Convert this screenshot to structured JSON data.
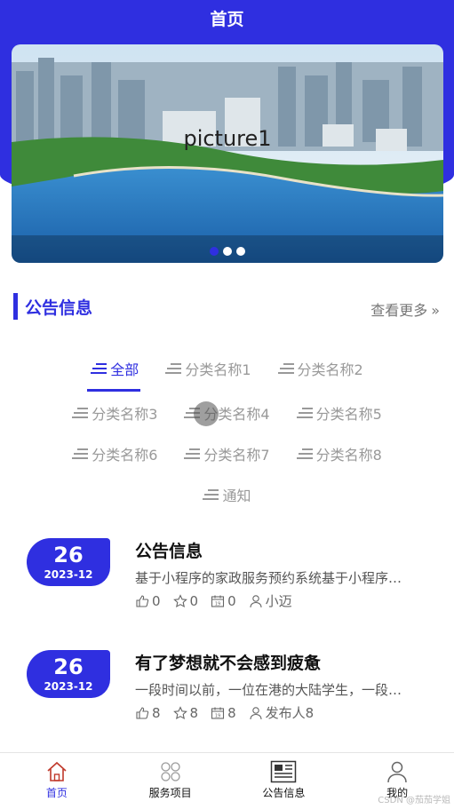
{
  "header": {
    "title": "首页"
  },
  "banner": {
    "caption": "picture1",
    "dots": 3,
    "active_dot": 0
  },
  "notice_section": {
    "title": "公告信息",
    "more_label": "查看更多",
    "more_icon": "double-chevron-right-icon"
  },
  "categories": [
    {
      "label": "全部",
      "active": true
    },
    {
      "label": "分类名称1"
    },
    {
      "label": "分类名称2"
    },
    {
      "label": "分类名称3"
    },
    {
      "label": "分类名称4"
    },
    {
      "label": "分类名称5"
    },
    {
      "label": "分类名称6"
    },
    {
      "label": "分类名称7"
    },
    {
      "label": "分类名称8"
    },
    {
      "label": "通知"
    }
  ],
  "news": [
    {
      "day": "26",
      "year_month": "2023-12",
      "title": "公告信息",
      "desc": "基于小程序的家政服务预约系统基于小程序的家政服务预约系统",
      "likes": "0",
      "favorites": "0",
      "views": "0",
      "author": "小迈"
    },
    {
      "day": "26",
      "year_month": "2023-12",
      "title": "有了梦想就不会感到疲惫",
      "desc": "一段时间以前，一位在港的大陆学生，一段时间以前",
      "likes": "8",
      "favorites": "8",
      "views": "8",
      "author": "发布人8"
    }
  ],
  "tabbar": [
    {
      "label": "首页",
      "icon": "home-icon",
      "active": true
    },
    {
      "label": "服务项目",
      "icon": "grid-icon"
    },
    {
      "label": "公告信息",
      "icon": "newspaper-icon"
    },
    {
      "label": "我的",
      "icon": "user-icon"
    }
  ],
  "watermark": "CSDN @茄茄学姐",
  "colors": {
    "accent": "#2f2fe0",
    "text": "#111111",
    "muted": "#999999"
  }
}
